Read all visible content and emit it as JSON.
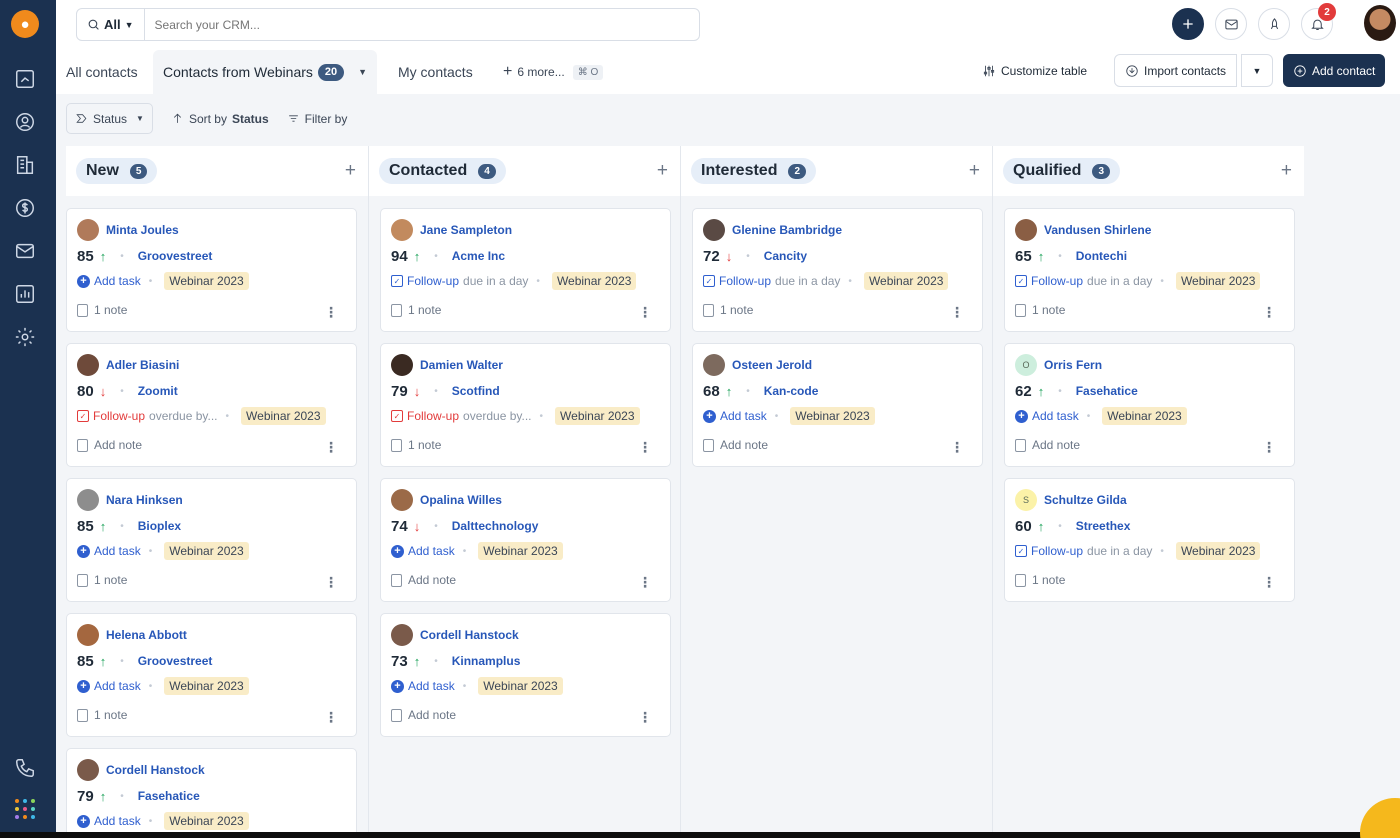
{
  "search": {
    "scope": "All",
    "placeholder": "Search your CRM..."
  },
  "notifications": {
    "count": "2"
  },
  "tabs": [
    {
      "label": "All contacts"
    },
    {
      "label": "Contacts from Webinars",
      "count": "20"
    },
    {
      "label": "My contacts"
    },
    {
      "label": "6 more...",
      "shortcut": "⌘ O"
    }
  ],
  "toolbar": {
    "customize": "Customize table",
    "import": "Import contacts",
    "add": "Add contact"
  },
  "filters": {
    "status": "Status",
    "sort_prefix": "Sort by",
    "sort_field": "Status",
    "filter": "Filter by"
  },
  "columns": [
    {
      "title": "New",
      "count": "5",
      "cards": [
        {
          "name": "Minta Joules",
          "score": "85",
          "trend": "up",
          "company": "Groovestreet",
          "task_type": "add",
          "task_label": "Add task",
          "due": "",
          "tag": "Webinar 2023",
          "note": "1 note",
          "avatar": "#b07a5a"
        },
        {
          "name": "Adler Biasini",
          "score": "80",
          "trend": "down",
          "company": "Zoomit",
          "task_type": "overdue",
          "task_label": "Follow-up",
          "due": "overdue by...",
          "tag": "Webinar 2023",
          "note": "Add note",
          "avatar": "#6e4a3a"
        },
        {
          "name": "Nara Hinksen",
          "score": "85",
          "trend": "up",
          "company": "Bioplex",
          "task_type": "add",
          "task_label": "Add task",
          "due": "",
          "tag": "Webinar 2023",
          "note": "1 note",
          "avatar": "#8d8d8d"
        },
        {
          "name": "Helena Abbott",
          "score": "85",
          "trend": "up",
          "company": "Groovestreet",
          "task_type": "add",
          "task_label": "Add task",
          "due": "",
          "tag": "Webinar 2023",
          "note": "1 note",
          "avatar": "#a4673f"
        },
        {
          "name": "Cordell Hanstock",
          "score": "79",
          "trend": "up",
          "company": "Fasehatice",
          "task_type": "add",
          "task_label": "Add task",
          "due": "",
          "tag": "Webinar 2023",
          "note": "",
          "avatar": "#7a5a4a"
        }
      ]
    },
    {
      "title": "Contacted",
      "count": "4",
      "cards": [
        {
          "name": "Jane Sampleton",
          "score": "94",
          "trend": "up",
          "company": "Acme Inc",
          "task_type": "due",
          "task_label": "Follow-up",
          "due": "due in a day",
          "tag": "Webinar 2023",
          "note": "1 note",
          "avatar": "#c28a5e"
        },
        {
          "name": "Damien Walter",
          "score": "79",
          "trend": "down",
          "company": "Scotfind",
          "task_type": "overdue",
          "task_label": "Follow-up",
          "due": "overdue by...",
          "tag": "Webinar 2023",
          "note": "1 note",
          "avatar": "#3a2a22"
        },
        {
          "name": "Opalina Willes",
          "score": "74",
          "trend": "down",
          "company": "Dalttechnology",
          "task_type": "add",
          "task_label": "Add task",
          "due": "",
          "tag": "Webinar 2023",
          "note": "Add note",
          "avatar": "#9b6a48"
        },
        {
          "name": "Cordell Hanstock",
          "score": "73",
          "trend": "up",
          "company": "Kinnamplus",
          "task_type": "add",
          "task_label": "Add task",
          "due": "",
          "tag": "Webinar 2023",
          "note": "Add note",
          "avatar": "#7a5a4a"
        }
      ]
    },
    {
      "title": "Interested",
      "count": "2",
      "cards": [
        {
          "name": "Glenine Bambridge",
          "score": "72",
          "trend": "down",
          "company": "Cancity",
          "task_type": "due",
          "task_label": "Follow-up",
          "due": "due in a day",
          "tag": "Webinar 2023",
          "note": "1 note",
          "avatar": "#5a4a44"
        },
        {
          "name": "Osteen Jerold",
          "score": "68",
          "trend": "up",
          "company": "Kan-code",
          "task_type": "add",
          "task_label": "Add task",
          "due": "",
          "tag": "Webinar 2023",
          "note": "Add note",
          "avatar": "#7d6a5e"
        }
      ]
    },
    {
      "title": "Qualified",
      "count": "3",
      "cards": [
        {
          "name": "Vandusen Shirlene",
          "score": "65",
          "trend": "up",
          "company": "Dontechi",
          "task_type": "due",
          "task_label": "Follow-up",
          "due": "due in a day",
          "tag": "Webinar 2023",
          "note": "1 note",
          "avatar": "#8a5e44"
        },
        {
          "name": "Orris Fern",
          "score": "62",
          "trend": "up",
          "company": "Fasehatice",
          "task_type": "add",
          "task_label": "Add task",
          "due": "",
          "tag": "Webinar 2023",
          "note": "Add note",
          "avatar": "#cdeedd",
          "initial": "O"
        },
        {
          "name": "Schultze Gilda",
          "score": "60",
          "trend": "up",
          "company": "Streethex",
          "task_type": "due",
          "task_label": "Follow-up",
          "due": "due in a day",
          "tag": "Webinar 2023",
          "note": "1 note",
          "avatar": "#fbf2a8",
          "initial": "S"
        }
      ]
    }
  ],
  "colors": {
    "sidebar": "#1b3150",
    "accent": "#2757b8",
    "tag_bg": "#f9ecc7",
    "up": "#1fa35b",
    "down": "#e23b3b"
  }
}
